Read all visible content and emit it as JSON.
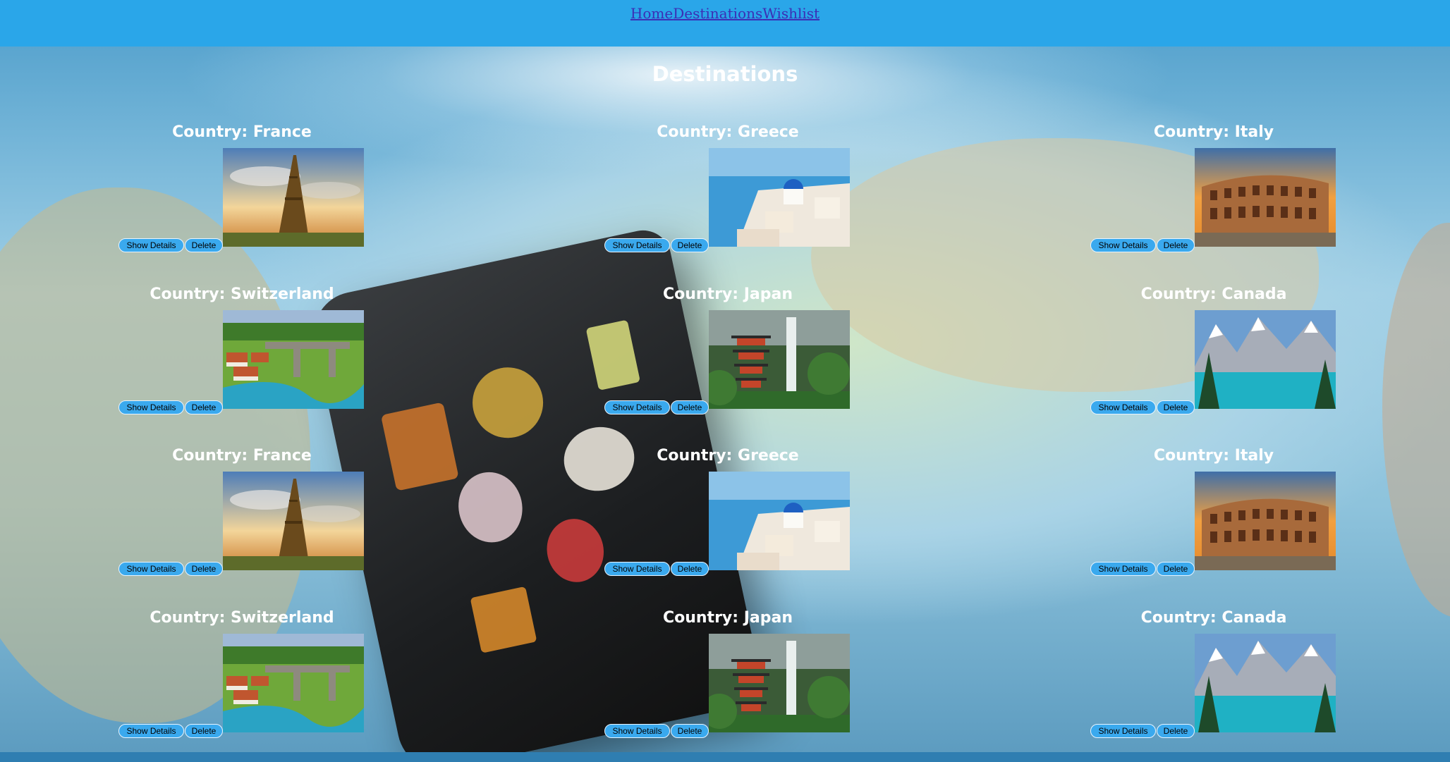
{
  "nav": {
    "links": [
      "Home",
      "Destinations",
      "Wishlist"
    ]
  },
  "page": {
    "title": "Destinations"
  },
  "card_buttons": {
    "details_label": "Show Details",
    "delete_label": "Delete"
  },
  "destinations": [
    {
      "country": "Country: France",
      "image": "eiffel-tower-photo"
    },
    {
      "country": "Country: Greece",
      "image": "santorini-photo"
    },
    {
      "country": "Country: Italy",
      "image": "colosseum-photo"
    },
    {
      "country": "Country: Switzerland",
      "image": "bern-river-photo"
    },
    {
      "country": "Country: Japan",
      "image": "pagoda-waterfall-photo"
    },
    {
      "country": "Country: Canada",
      "image": "mountain-lake-photo"
    },
    {
      "country": "Country: France",
      "image": "eiffel-tower-photo"
    },
    {
      "country": "Country: Greece",
      "image": "santorini-photo"
    },
    {
      "country": "Country: Italy",
      "image": "colosseum-photo"
    },
    {
      "country": "Country: Switzerland",
      "image": "bern-river-photo"
    },
    {
      "country": "Country: Japan",
      "image": "pagoda-waterfall-photo"
    },
    {
      "country": "Country: Canada",
      "image": "mountain-lake-photo"
    }
  ],
  "colors": {
    "navbar": "#2aa6e9",
    "nav_link": "#3b2fb5",
    "button": "#3aa9ee"
  }
}
